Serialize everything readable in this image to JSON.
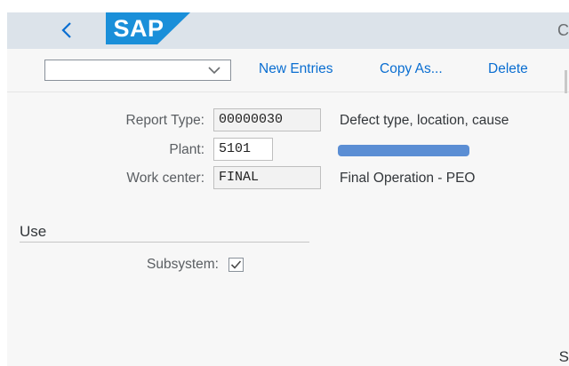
{
  "shell": {
    "logo_text": "SAP",
    "edge_char": "C",
    "brand_color": "#1a8fd9",
    "back_icon": "chevron-left-icon"
  },
  "toolbar": {
    "select_value": "",
    "select_icon": "chevron-down-icon",
    "new_entries_label": "New Entries",
    "copy_as_label": "Copy As...",
    "delete_label": "Delete"
  },
  "form": {
    "report_type": {
      "label": "Report Type:",
      "value": "00000030",
      "description": "Defect type, location, cause"
    },
    "plant": {
      "label": "Plant:",
      "value": "5101",
      "description_redacted": true
    },
    "work_center": {
      "label": "Work center:",
      "value": "FINAL",
      "description": "Final Operation - PEO"
    }
  },
  "section": {
    "title": "Use",
    "subsystem": {
      "label": "Subsystem:",
      "checked": true
    }
  },
  "footer": {
    "corner_char": "S"
  }
}
